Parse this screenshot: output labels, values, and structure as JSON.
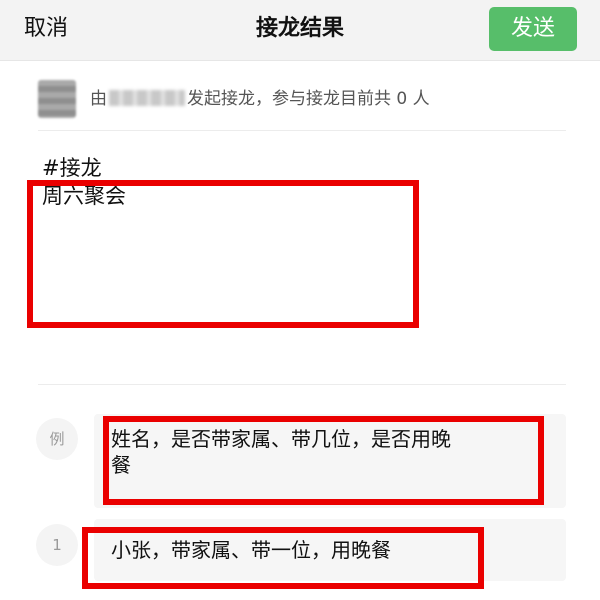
{
  "navbar": {
    "cancel_label": "取消",
    "title": "接龙结果",
    "send_label": "发送"
  },
  "initiator": {
    "prefix": "由",
    "suffix": "发起接龙，参与接龙目前共 0 人"
  },
  "topic": {
    "tag": "#接龙",
    "title": "周六聚会"
  },
  "entries": [
    {
      "index": "例",
      "text_line1": "姓名，是否带家属、带几位，是否用晚",
      "text_line2": "餐"
    },
    {
      "index": "1",
      "text": "小张，带家属、带一位，用晚餐"
    }
  ],
  "colors": {
    "send_button": "#57be6a",
    "highlight_box": "#ea0000",
    "navbar_bg": "#f3f3f3"
  }
}
